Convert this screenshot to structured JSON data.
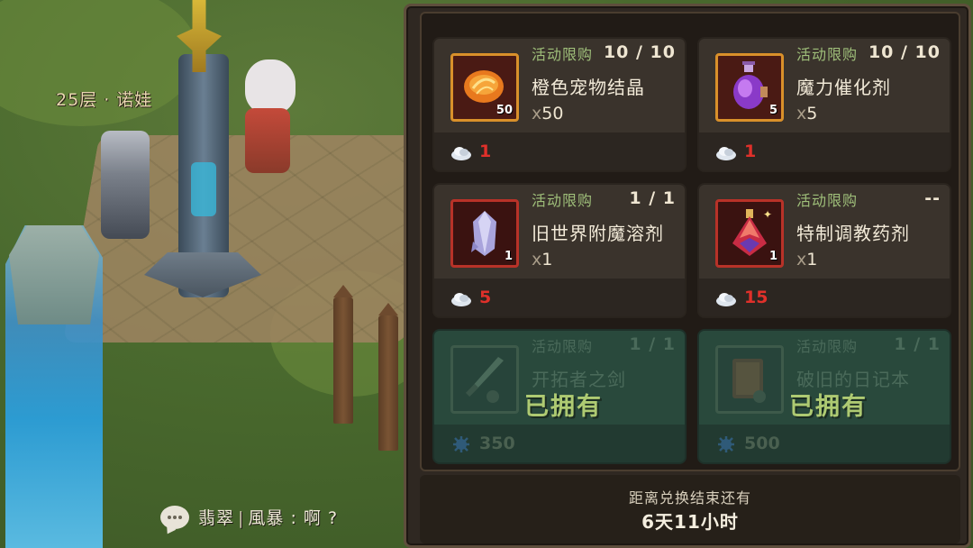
{
  "world": {
    "floor_label": "25层 · 诺娃"
  },
  "chat": {
    "channel": "翡翠",
    "message": "風暴 : 啊 ?"
  },
  "shop": {
    "items": [
      {
        "tag": "活动限购",
        "limit": "10 / 10",
        "name": "橙色宠物结晶",
        "qty_prefix": "x",
        "qty": "50",
        "icon_count": "50",
        "price": "1",
        "icon": "orange-crystal-icon",
        "owned": false
      },
      {
        "tag": "活动限购",
        "limit": "10 / 10",
        "name": "魔力催化剂",
        "qty_prefix": "x",
        "qty": "5",
        "icon_count": "5",
        "price": "1",
        "icon": "purple-potion-icon",
        "owned": false
      },
      {
        "tag": "活动限购",
        "limit": "1 / 1",
        "name": "旧世界附魔溶剂",
        "qty_prefix": "x",
        "qty": "1",
        "icon_count": "1",
        "price": "5",
        "icon": "blue-crystal-icon",
        "owned": false
      },
      {
        "tag": "活动限购",
        "limit": "--",
        "name": "特制调教药剂",
        "qty_prefix": "x",
        "qty": "1",
        "icon_count": "1",
        "price": "15",
        "icon": "red-flask-icon",
        "owned": false
      },
      {
        "tag": "活动限购",
        "limit": "1 / 1",
        "name": "开拓者之剑",
        "owned_label": "已拥有",
        "price": "350",
        "icon": "sword-icon",
        "owned": true
      },
      {
        "tag": "活动限购",
        "limit": "1 / 1",
        "name": "破旧的日记本",
        "owned_label": "已拥有",
        "price": "500",
        "icon": "journal-icon",
        "owned": true
      }
    ],
    "footer": {
      "line1": "距离兑换结束还有",
      "line2": "6天11小时"
    }
  },
  "colors": {
    "price_red": "#e0302a",
    "owned_green": "#aeca72",
    "tag_green": "#9fbf7a"
  }
}
